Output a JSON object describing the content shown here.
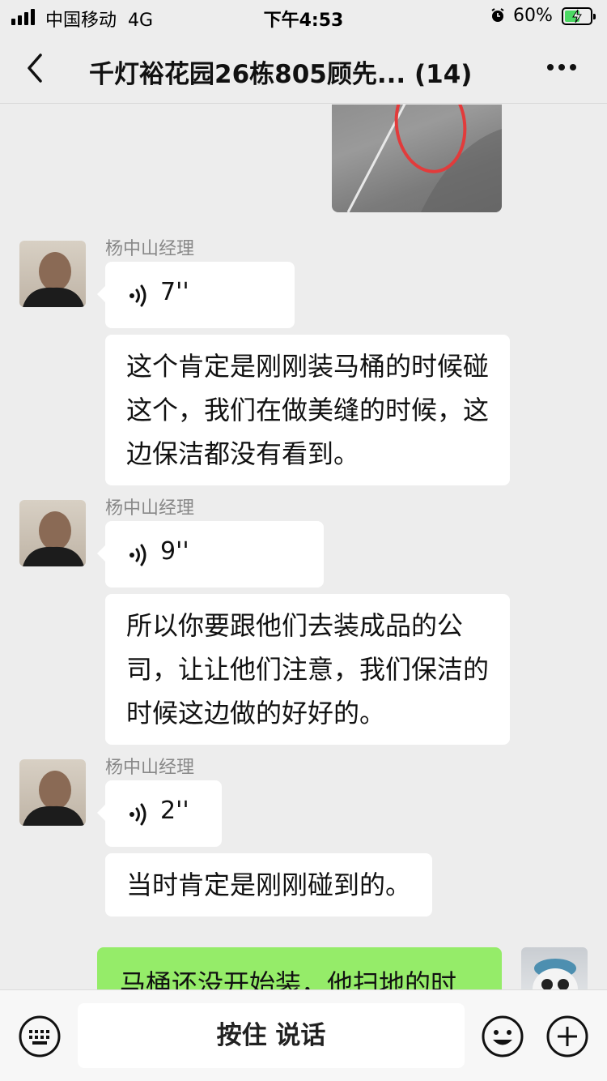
{
  "status_bar": {
    "carrier": "中国移动",
    "network": "4G",
    "time": "下午4:53",
    "battery_percent": "60%",
    "battery_level": 0.6
  },
  "nav": {
    "title": "千灯裕花园26栋805顾先... (14)"
  },
  "messages": [
    {
      "sender": "杨中山经理",
      "voice_duration": "7''",
      "text": "这个肯定是刚刚装马桶的时候碰这个，我们在做美缝的时候，这边保洁都没有看到。"
    },
    {
      "sender": "杨中山经理",
      "voice_duration": "9''",
      "text": "所以你要跟他们去装成品的公司，让让他们注意，我们保洁的时候这边做的好好的。"
    },
    {
      "sender": "杨中山经理",
      "voice_duration": "2''",
      "text": "当时肯定是刚刚碰到的。"
    }
  ],
  "my_message": {
    "text": "马桶还没开始装，他扫地的时"
  },
  "input_bar": {
    "push_to_talk": "按住 说话"
  },
  "icons": {
    "back": "chevron-left-icon",
    "more": "more-dots-icon",
    "voice": "voice-wave-icon",
    "keyboard": "keyboard-icon",
    "emoji": "emoji-icon",
    "plus": "plus-icon"
  },
  "colors": {
    "background": "#ededed",
    "my_bubble": "#95ec69",
    "other_bubble": "#ffffff",
    "battery_fill": "#4cd964"
  }
}
